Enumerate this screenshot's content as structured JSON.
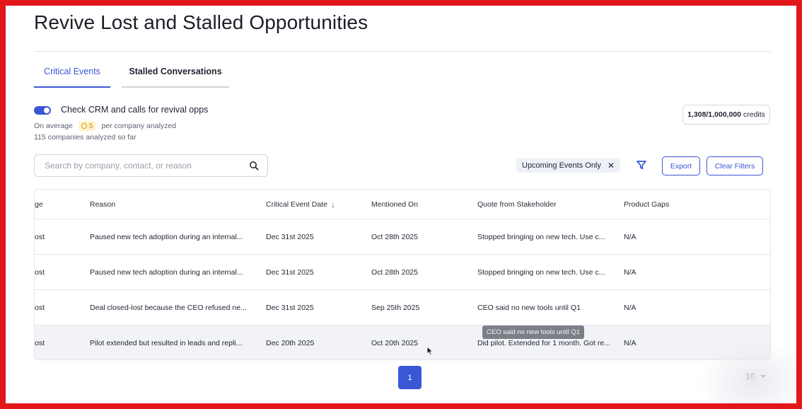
{
  "page": {
    "title": "Revive Lost and Stalled Opportunities"
  },
  "tabs": [
    {
      "label": "Critical Events",
      "active": true
    },
    {
      "label": "Stalled Conversations",
      "active": false
    }
  ],
  "revival": {
    "toggle_on": true,
    "toggle_label": "Check CRM and calls for revival opps",
    "avg_prefix": "On average",
    "avg_badge": "5",
    "avg_suffix": "per company analyzed",
    "analyzed_text": "115 companies analyzed so far"
  },
  "credits": {
    "used": "1,308/1,000,000",
    "label": "credits"
  },
  "search": {
    "placeholder": "Search by company, contact, or reason",
    "value": ""
  },
  "filters": {
    "chip_label": "Upcoming Events Only",
    "export_label": "Export",
    "clear_label": "Clear Filters"
  },
  "table": {
    "columns": [
      "ge",
      "Reason",
      "Critical Event Date",
      "Mentioned On",
      "Quote from Stakeholder",
      "Product Gaps"
    ],
    "sorted_column": "Critical Event Date",
    "rows": [
      [
        "ost",
        "Paused new tech adoption during an internal...",
        "Dec 31st 2025",
        "Oct 28th 2025",
        "Stopped bringing on new tech. Use c...",
        "N/A"
      ],
      [
        "ost",
        "Paused new tech adoption during an internal...",
        "Dec 31st 2025",
        "Oct 28th 2025",
        "Stopped bringing on new tech. Use c...",
        "N/A"
      ],
      [
        "ost",
        "Deal closed-lost because the CEO refused ne...",
        "Dec 31st 2025",
        "Sep 25th 2025",
        "CEO said no new tools until Q1",
        "N/A"
      ],
      [
        "ost",
        "Pilot extended but resulted in leads and repli...",
        "Dec 20th 2025",
        "Oct 20th 2025",
        "Did pilot. Extended for 1 month. Got re...",
        "N/A"
      ]
    ]
  },
  "tooltip": {
    "text": "CEO said no new tools until Q1"
  },
  "pagination": {
    "current_page": "1",
    "per_page": "10"
  },
  "colors": {
    "accent": "#3a57d6",
    "frame": "#e3171b",
    "badge_bg": "#fff4cc",
    "badge_fg": "#c98a00"
  }
}
